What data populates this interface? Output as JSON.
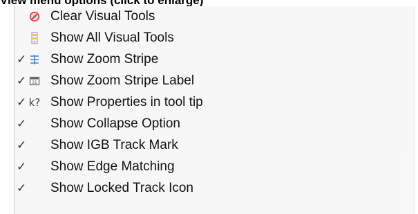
{
  "caption": "View menu options (click to enlarge)",
  "menu": {
    "items": [
      {
        "label": "Clear Visual Tools",
        "checked": false,
        "icon": "clear-visual-tools-icon"
      },
      {
        "label": "Show All Visual Tools",
        "checked": false,
        "icon": "show-all-visual-tools-icon"
      },
      {
        "label": "Show Zoom Stripe",
        "checked": true,
        "icon": "zoom-stripe-icon"
      },
      {
        "label": "Show Zoom Stripe Label",
        "checked": true,
        "icon": "zoom-stripe-label-icon"
      },
      {
        "label": "Show Properties in tool tip",
        "checked": true,
        "icon": "properties-tooltip-icon"
      },
      {
        "label": "Show Collapse Option",
        "checked": true,
        "icon": ""
      },
      {
        "label": "Show IGB Track Mark",
        "checked": true,
        "icon": ""
      },
      {
        "label": "Show Edge Matching",
        "checked": true,
        "icon": ""
      },
      {
        "label": "Show Locked Track Icon",
        "checked": true,
        "icon": ""
      }
    ]
  },
  "glyphs": {
    "check": "✓",
    "zoom_stripe_label_text": "31",
    "properties_tooltip_text": "k?"
  }
}
